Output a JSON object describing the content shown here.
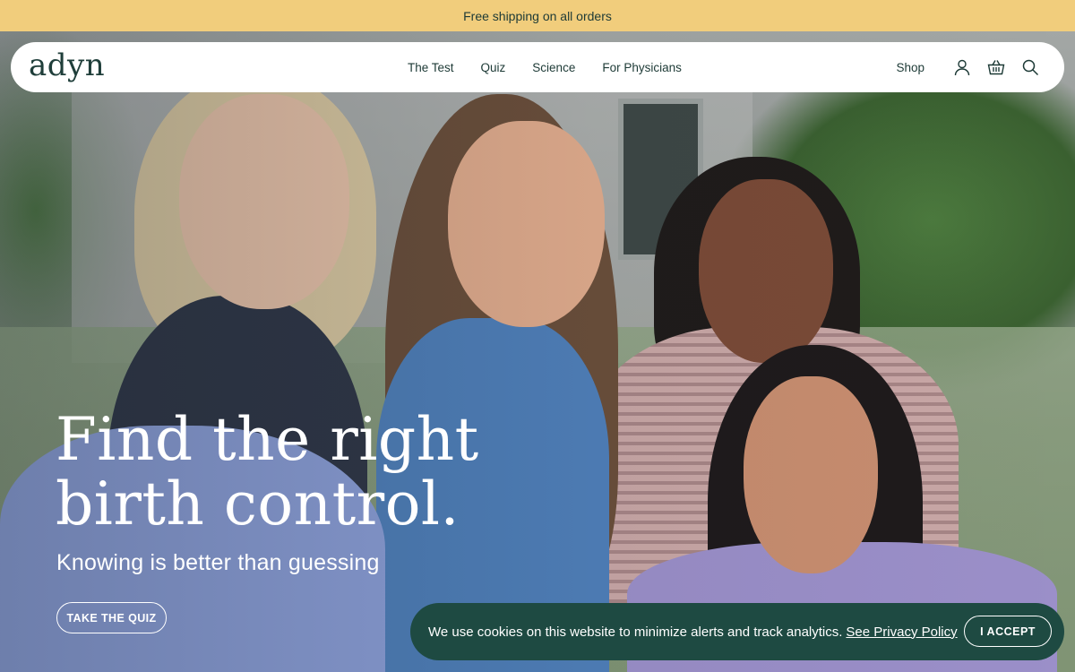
{
  "announcement": {
    "text": "Free shipping on all orders"
  },
  "header": {
    "logo": "adyn",
    "nav_links": [
      {
        "label": "The Test"
      },
      {
        "label": "Quiz"
      },
      {
        "label": "Science"
      },
      {
        "label": "For Physicians"
      }
    ],
    "shop_label": "Shop",
    "icons": [
      "account-icon",
      "basket-icon",
      "search-icon"
    ]
  },
  "hero": {
    "headline_line1": "Find the right",
    "headline_line2": "birth control.",
    "subheading": "Knowing is better than guessing",
    "cta_label": "TAKE THE QUIZ"
  },
  "cookie_banner": {
    "text": "We use cookies on this website to minimize alerts and track analytics.",
    "link_label": "See Privacy Policy",
    "accept_label": "I ACCEPT"
  },
  "colors": {
    "announcement_bg": "#f1cd7c",
    "brand_dark": "#1d3a36",
    "cookie_bg": "#1e4a42"
  }
}
